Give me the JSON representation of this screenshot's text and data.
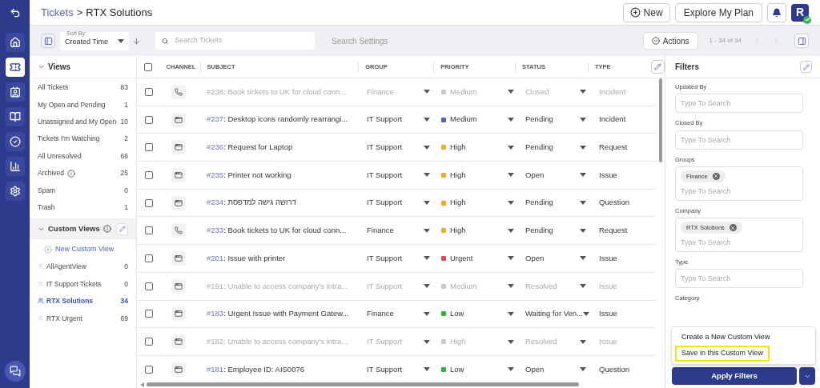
{
  "breadcrumb": {
    "parent": "Tickets",
    "separator": ">",
    "current": "RTX Solutions"
  },
  "header_buttons": {
    "new": "New",
    "plan": "Explore My Plan",
    "avatar": "R",
    "avatar_online": true
  },
  "rail": [
    {
      "kind": "logo",
      "selected": false
    },
    {
      "kind": "home",
      "selected": false
    },
    {
      "kind": "ticket",
      "selected": true
    },
    {
      "kind": "contact",
      "selected": false
    },
    {
      "kind": "book",
      "selected": false
    },
    {
      "kind": "check",
      "selected": false
    },
    {
      "kind": "chart",
      "selected": false
    },
    {
      "kind": "gear",
      "selected": false
    }
  ],
  "toolbar": {
    "sort_label": "Sort By:",
    "sort_value": "Created Time",
    "search_placeholder": "Search Tickets",
    "search_settings": "Search Settings",
    "actions": "Actions",
    "pagination": "1 - 34 of 34"
  },
  "views": {
    "title": "Views",
    "items": [
      {
        "label": "All Tickets",
        "count": "83",
        "info": false
      },
      {
        "label": "My Open and Pending",
        "count": "1",
        "info": false
      },
      {
        "label": "Unassigned and My Open",
        "count": "10",
        "info": false
      },
      {
        "label": "Tickets I'm Watching",
        "count": "2",
        "info": false
      },
      {
        "label": "All Unresolved",
        "count": "66",
        "info": false
      },
      {
        "label": "Archived",
        "count": "25",
        "info": true
      },
      {
        "label": "Spam",
        "count": "0",
        "info": false
      },
      {
        "label": "Trash",
        "count": "1",
        "info": false
      }
    ]
  },
  "custom_views": {
    "title": "Custom Views",
    "new_label": "New Custom View",
    "items": [
      {
        "label": "AllAgentView",
        "count": "0",
        "selected": false
      },
      {
        "label": "IT Support Tickets",
        "count": "0",
        "selected": false
      },
      {
        "label": "RTX Solutions",
        "count": "34",
        "selected": true
      },
      {
        "label": "RTX Urgent",
        "count": "69",
        "selected": false
      }
    ]
  },
  "table": {
    "columns": [
      "CHANNEL",
      "SUBJECT",
      "GROUP",
      "PRIORITY",
      "STATUS",
      "TYPE"
    ],
    "select_all_checked": false,
    "rows": [
      {
        "checked": false,
        "kind": "phone",
        "muted": true,
        "number": "#238",
        "subject": ": Book tickets to UK for cloud conn...",
        "group": "Finance",
        "priority": "Medium",
        "color": "#c8c8c8",
        "status": "Closed",
        "type": "Incident"
      },
      {
        "checked": false,
        "kind": "web",
        "muted": false,
        "number": "#237",
        "subject": ": Desktop icons randomly rearrangi...",
        "group": "IT Support",
        "priority": "Medium",
        "color": "#5c63b5",
        "status": "Pending",
        "type": "Incident"
      },
      {
        "checked": false,
        "kind": "web",
        "muted": false,
        "number": "#236",
        "subject": ": Request for Laptop",
        "group": "IT Support",
        "priority": "High",
        "color": "#f5a623",
        "status": "Pending",
        "type": "Request"
      },
      {
        "checked": false,
        "kind": "web",
        "muted": false,
        "number": "#235",
        "subject": ": Printer not working",
        "group": "IT Support",
        "priority": "High",
        "color": "#f5a623",
        "status": "Open",
        "type": "Issue"
      },
      {
        "checked": false,
        "kind": "web",
        "muted": false,
        "number": "#234",
        "subject": ": דרושה גישה למדפסת",
        "group": "IT Support",
        "priority": "High",
        "color": "#f5a623",
        "status": "Pending",
        "type": "Question"
      },
      {
        "checked": false,
        "kind": "phone",
        "muted": false,
        "number": "#233",
        "subject": ": Book tickets to UK for cloud conn...",
        "group": "Finance",
        "priority": "High",
        "color": "#f5a623",
        "status": "Pending",
        "type": "Request"
      },
      {
        "checked": false,
        "kind": "web",
        "muted": false,
        "number": "#201",
        "subject": ": Issue with printer",
        "group": "IT Support",
        "priority": "Urgent",
        "color": "#e94b55",
        "status": "Open",
        "type": "Issue"
      },
      {
        "checked": false,
        "kind": "web",
        "muted": true,
        "number": "#191",
        "subject": ": Unable to access company's intra...",
        "group": "IT Support",
        "priority": "Medium",
        "color": "#c8c8c8",
        "status": "Resolved",
        "type": "Issue"
      },
      {
        "checked": false,
        "kind": "web",
        "muted": false,
        "number": "#183",
        "subject": ": Urgent Issue with Payment Gatew...",
        "group": "Finance",
        "priority": "Low",
        "color": "#2fb344",
        "status": "Waiting for Ven...",
        "type": "Issue"
      },
      {
        "checked": false,
        "kind": "web",
        "muted": true,
        "number": "#182",
        "subject": ": Unable to access company's intra...",
        "group": "IT Support",
        "priority": "High",
        "color": "#c8c8c8",
        "status": "Resolved",
        "type": "Issue"
      },
      {
        "checked": false,
        "kind": "web",
        "muted": false,
        "number": "#181",
        "subject": ": Employee ID: AIS0076",
        "group": "IT Support",
        "priority": "Low",
        "color": "#2fb344",
        "status": "Open",
        "type": "Question"
      }
    ]
  },
  "filters": {
    "title": "Filters",
    "fields": [
      {
        "label": "Updated By",
        "placeholder": "Type To Search"
      },
      {
        "label": "Closed By",
        "placeholder": "Type To Search"
      },
      {
        "label": "Groups",
        "placeholder": "Type To Search",
        "chips": [
          "Finance"
        ]
      },
      {
        "label": "Company",
        "placeholder": "Type To Search",
        "chips": [
          "RTX Solutions"
        ]
      },
      {
        "label": "Type",
        "placeholder": "Type To Search"
      },
      {
        "label": "Category"
      }
    ],
    "menu": [
      {
        "label": "Create a New Custom View",
        "highlighted": false
      },
      {
        "label": "Save in this Custom View",
        "highlighted": true
      }
    ],
    "apply": "Apply Filters"
  }
}
